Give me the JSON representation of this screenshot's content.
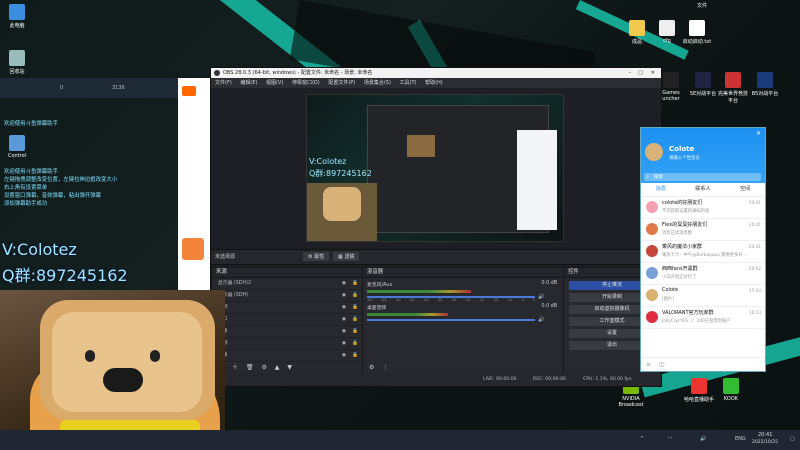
{
  "desktop": {
    "icons_left": [
      {
        "label": "此电脑",
        "icon": "computer-icon"
      },
      {
        "label": "回收站",
        "icon": "recycle-bin-icon"
      },
      {
        "label": "Control",
        "icon": "control-panel-icon"
      }
    ],
    "icons_right": [
      {
        "label": "文件",
        "icon": "folder-icon"
      },
      {
        "label": "成品",
        "icon": "folder-icon"
      },
      {
        "label": "cfg",
        "icon": "file-icon"
      },
      {
        "label": "启动启动.txt",
        "icon": "text-file-icon"
      },
      {
        "label": "5E对战平台",
        "icon": "5e-app-icon"
      },
      {
        "label": "完美世界竞技平台",
        "icon": "perfect-world-icon"
      },
      {
        "label": "B5对战平台",
        "icon": "b5-app-icon"
      },
      {
        "label": "Games\nuncher",
        "icon": "epic-games-icon"
      },
      {
        "label": "NVIDIA Broadcast",
        "icon": "nvidia-broadcast-icon"
      },
      {
        "label": "哈哈直播助手",
        "icon": "stream-assistant-icon"
      },
      {
        "label": "KOOK",
        "icon": "kook-icon"
      }
    ]
  },
  "overlay": {
    "lines": [
      "欢迎使用斗鱼弹幕助手",
      "左键拖拽调整改变位置，左键拉伸边框改变大小",
      "右上角有设置菜单",
      "设置窗口弹幕，音效弹幕，粘出弹开弹幕",
      "添加弹幕助手成功"
    ],
    "big_line1": "V:Colotez",
    "big_line2": "Q群:897245162",
    "small_stats": [
      "0",
      "3136"
    ]
  },
  "obs": {
    "title": "OBS 28.0.3 (64-bit, windows) - 配置文件: 未命名 - 场景: 未命名",
    "menu": [
      "文件(F)",
      "编辑(E)",
      "视图(V)",
      "停靠窗口(D)",
      "配置文件(P)",
      "场景集合(S)",
      "工具(T)",
      "帮助(H)"
    ],
    "preview_text1": "V:Colotez",
    "preview_text2": "Q群:897245162",
    "source_bar": {
      "label": "未选择源",
      "properties": "属性",
      "filters": "滤镜"
    },
    "sources_panel": {
      "title": "来源",
      "items": [
        "显示器 (SDH)2",
        "显示器 (SDH)",
        "视频",
        "窗口",
        "图像",
        "视频",
        "图像"
      ]
    },
    "mixer_panel": {
      "title": "混音器",
      "channels": [
        {
          "name": "麦克风/Aux",
          "db": "0.0 dB",
          "level": 0.62
        },
        {
          "name": "桌面音频",
          "db": "0.0 dB",
          "level": 0.48
        }
      ],
      "scale": [
        "-60",
        "-55",
        "-50",
        "-45",
        "-40",
        "-35",
        "-30",
        "-25",
        "-20",
        "-15",
        "-10",
        "-5",
        "0"
      ]
    },
    "controls_panel": {
      "title": "控件",
      "buttons": [
        "停止推流",
        "开始录制",
        "启动虚拟摄像机",
        "工作室模式",
        "设置",
        "退出"
      ]
    },
    "status": {
      "live": "LIVE: 00:00:00",
      "rec": "REC: 00:00:00",
      "cpu": "CPU: 1.1%, 60.00 fps"
    }
  },
  "qq": {
    "name": "Colote",
    "status": "请输入个性签名",
    "search_placeholder": "搜索",
    "tabs": [
      "消息",
      "联系人",
      "空间"
    ],
    "chats": [
      {
        "name": "colote的好朋友们",
        "msg": "不可获取设置的通知内容",
        "time": "20:41",
        "color": "#f5a0b0"
      },
      {
        "name": "Flex的臭臭好朋友们",
        "msg": "消息已读消息数",
        "time": "20:41",
        "color": "#e07a4a"
      },
      {
        "name": "乘风的魔法小家群",
        "msg": "乘风卡卡：中午@Barbapapa 需要更多开...",
        "time": "20:41",
        "color": "#c5453a"
      },
      {
        "name": "西西fans开黑群",
        "msg": "小白开始正好打了",
        "time": "20:02",
        "color": "#7aa0d8"
      },
      {
        "name": "Colote",
        "msg": "[图片]",
        "time": "15:04",
        "color": "#d8b070"
      },
      {
        "name": "VALORANT官方玩家群",
        "msg": "JollyCry(YES..)：100已投票到账户",
        "time": "10:13",
        "color": "#e03040"
      }
    ]
  },
  "taskbar": {
    "time": "20:41",
    "date": "2022/10/25",
    "lang": "ENG"
  }
}
